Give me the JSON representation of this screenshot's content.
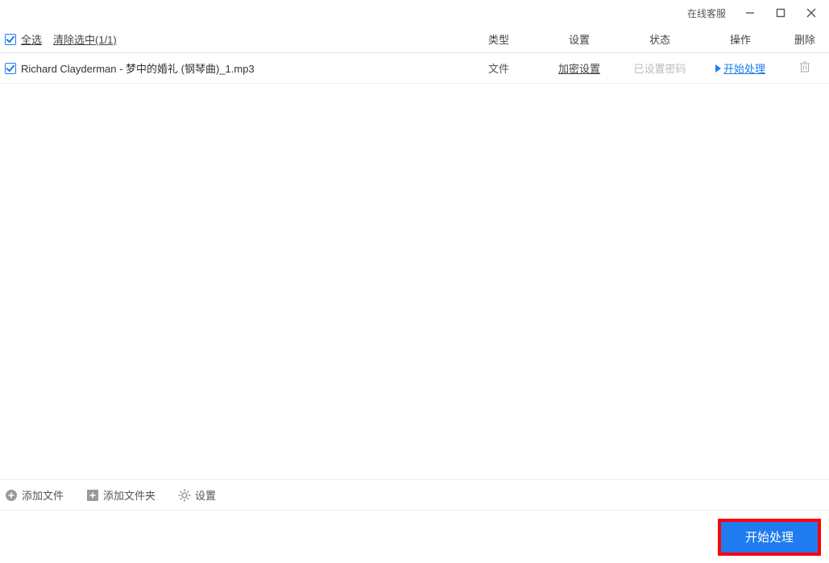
{
  "titlebar": {
    "customer_service": "在线客服"
  },
  "header": {
    "select_all": "全选",
    "clear_selection": "清除选中(1/1)",
    "col_type": "类型",
    "col_setting": "设置",
    "col_status": "状态",
    "col_action": "操作",
    "col_delete": "删除"
  },
  "rows": [
    {
      "name": "Richard Clayderman - 梦中的婚礼 (钢琴曲)_1.mp3",
      "type": "文件",
      "setting": "加密设置",
      "status": "已设置密码",
      "action": "开始处理"
    }
  ],
  "toolbar": {
    "add_file": "添加文件",
    "add_folder": "添加文件夹",
    "settings": "设置"
  },
  "footer": {
    "start": "开始处理"
  }
}
